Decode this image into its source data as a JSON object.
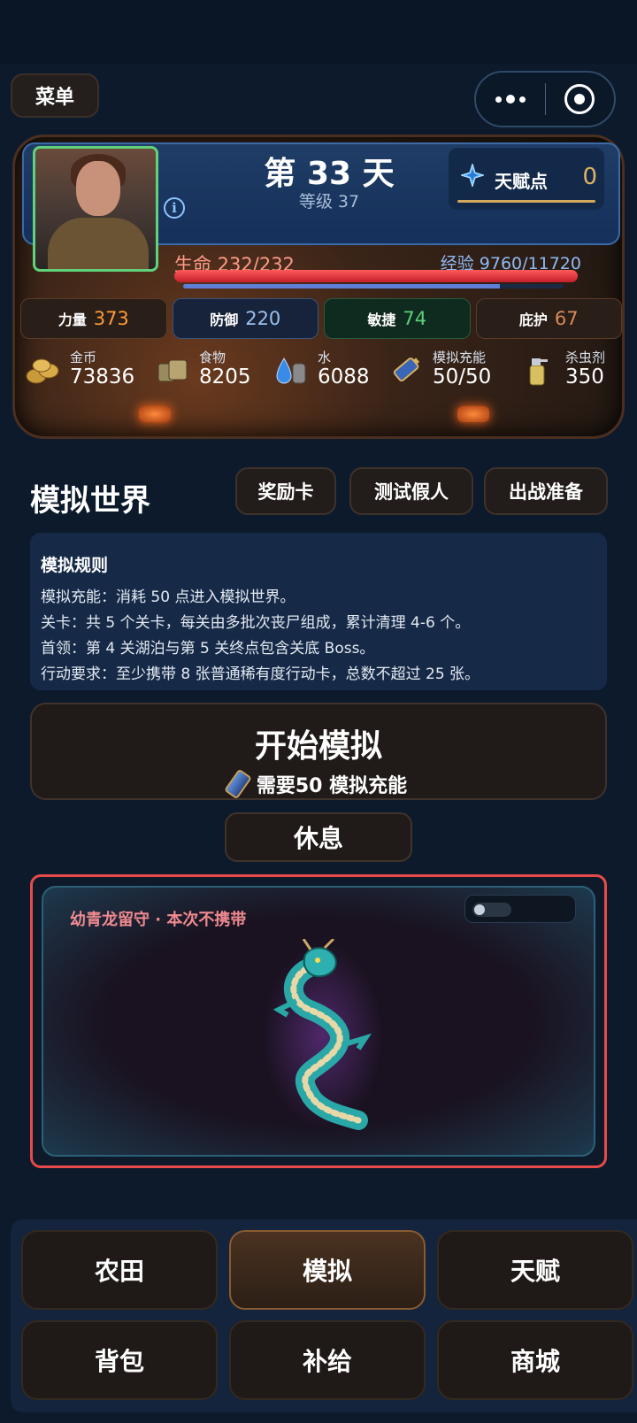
{
  "header": {
    "menu_label": "菜单"
  },
  "status": {
    "day": "第 33 天",
    "level": "等级 37",
    "talent_label": "天赋点",
    "talent_value": "0",
    "hp_text": "生命 232/232",
    "hp_fraction": 1.0,
    "xp_text": "经验 9760/11720",
    "xp_fraction": 0.833,
    "stats": [
      {
        "label": "力量",
        "value": "373"
      },
      {
        "label": "防御",
        "value": "220"
      },
      {
        "label": "敏捷",
        "value": "74"
      },
      {
        "label": "庇护",
        "value": "67"
      }
    ],
    "resources": [
      {
        "label": "金币",
        "value": "73836",
        "icon": "coins-icon"
      },
      {
        "label": "食物",
        "value": "8205",
        "icon": "food-icon"
      },
      {
        "label": "水",
        "value": "6088",
        "icon": "water-icon"
      },
      {
        "label": "模拟充能",
        "value": "50/50",
        "icon": "battery-icon"
      },
      {
        "label": "杀虫剂",
        "value": "350",
        "icon": "spray-icon"
      }
    ]
  },
  "section": {
    "title": "模拟世界",
    "buttons": [
      "奖励卡",
      "测试假人",
      "出战准备"
    ]
  },
  "rules": {
    "title": "模拟规则",
    "lines": [
      "模拟充能：消耗 50 点进入模拟世界。",
      "关卡：共 5 个关卡，每关由多批次丧尸组成，累计清理 4-6 个。",
      "首领：第 4 关湖泊与第 5 关终点包含关底 Boss。",
      "行动要求：至少携带 8 张普通稀有度行动卡，总数不超过 25 张。"
    ]
  },
  "start": {
    "title": "开始模拟",
    "subtitle": "需要50 模拟充能"
  },
  "rest_label": "休息",
  "pet": {
    "label": "幼青龙留守 · 本次不携带",
    "toggle_on": false
  },
  "nav": [
    "农田",
    "模拟",
    "天赋",
    "背包",
    "补给",
    "商城"
  ],
  "nav_active": "模拟",
  "colors": {
    "accent_gold": "#e0b463",
    "hp_red": "#e02a36",
    "danger_border": "#e84a4a"
  }
}
